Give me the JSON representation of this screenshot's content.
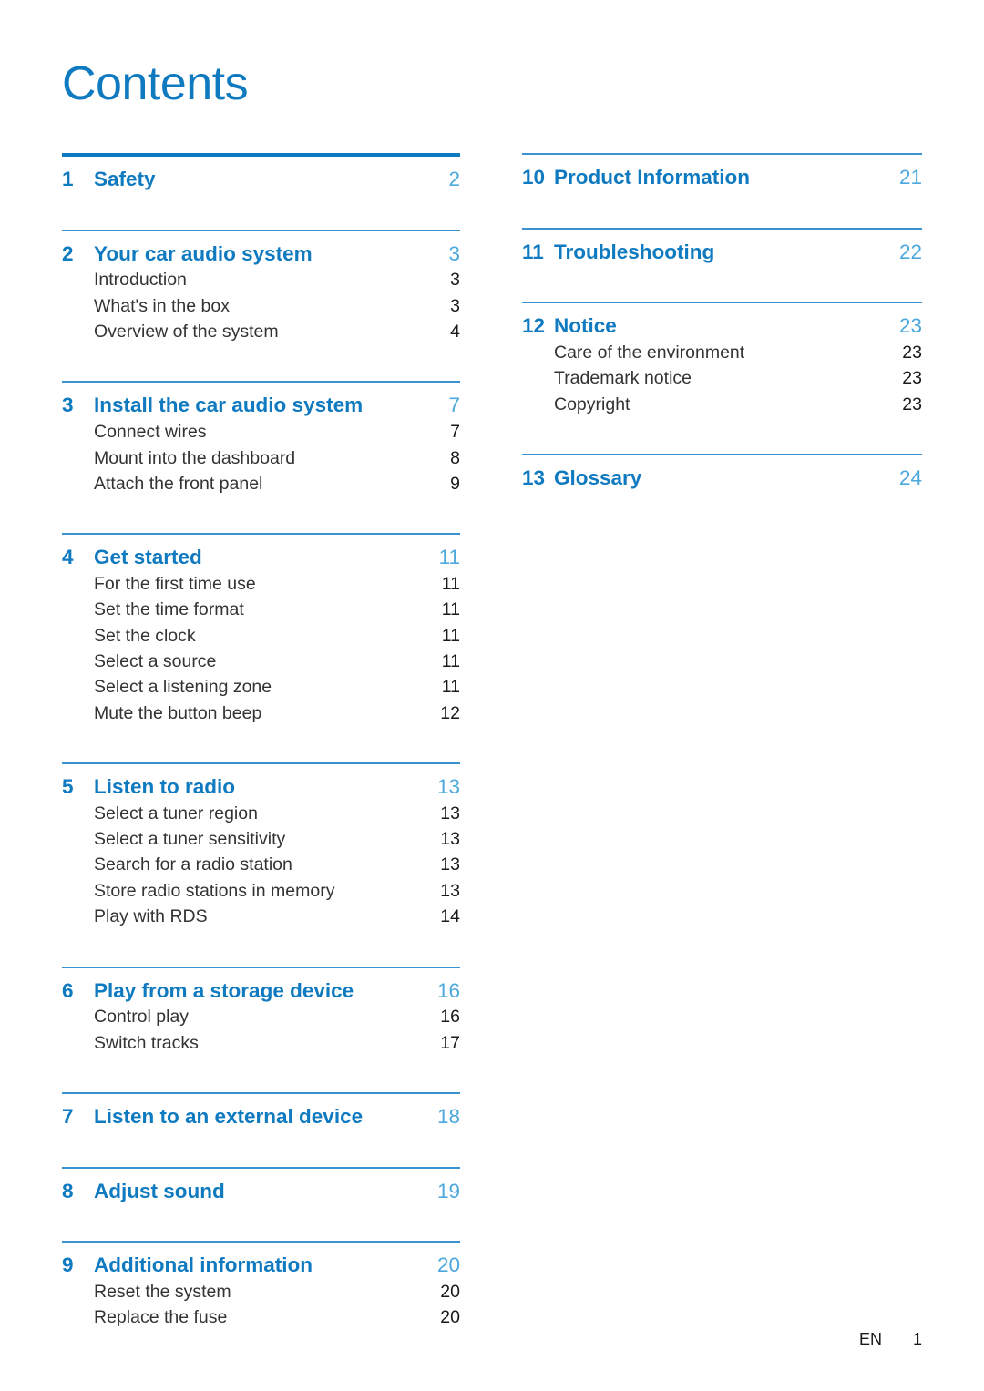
{
  "document": {
    "title": "Contents"
  },
  "colors": {
    "heading_blue": "#0f7ac0",
    "page_number_blue": "#4da8dd",
    "rule_blue": "#3a93cf",
    "body_text": "#333333"
  },
  "left_column": [
    {
      "number": "1",
      "title": "Safety",
      "page": "2",
      "rule": "heavy",
      "subitems": []
    },
    {
      "number": "2",
      "title": "Your car audio system",
      "page": "3",
      "rule": "thin",
      "subitems": [
        {
          "title": "Introduction",
          "page": "3"
        },
        {
          "title": "What's in the box",
          "page": "3"
        },
        {
          "title": "Overview of the system",
          "page": "4"
        }
      ]
    },
    {
      "number": "3",
      "title": "Install the car audio system",
      "page": "7",
      "rule": "thin",
      "subitems": [
        {
          "title": "Connect wires",
          "page": "7"
        },
        {
          "title": "Mount into the dashboard",
          "page": "8"
        },
        {
          "title": "Attach the front panel",
          "page": "9"
        }
      ]
    },
    {
      "number": "4",
      "title": "Get started",
      "page": "11",
      "rule": "thin",
      "subitems": [
        {
          "title": "For the first time use",
          "page": "11"
        },
        {
          "title": "Set the time format",
          "page": "11"
        },
        {
          "title": "Set the clock",
          "page": "11"
        },
        {
          "title": "Select a source",
          "page": "11"
        },
        {
          "title": "Select a listening zone",
          "page": "11"
        },
        {
          "title": "Mute the button beep",
          "page": "12"
        }
      ]
    },
    {
      "number": "5",
      "title": "Listen to radio",
      "page": "13",
      "rule": "thin",
      "subitems": [
        {
          "title": "Select a tuner region",
          "page": "13"
        },
        {
          "title": "Select a tuner sensitivity",
          "page": "13"
        },
        {
          "title": "Search for a radio station",
          "page": "13"
        },
        {
          "title": "Store radio stations in memory",
          "page": "13"
        },
        {
          "title": "Play with RDS",
          "page": "14"
        }
      ]
    },
    {
      "number": "6",
      "title": "Play from a storage device",
      "page": "16",
      "rule": "thin",
      "subitems": [
        {
          "title": "Control play",
          "page": "16"
        },
        {
          "title": "Switch tracks",
          "page": "17"
        }
      ]
    },
    {
      "number": "7",
      "title": "Listen to an external device",
      "page": "18",
      "rule": "thin",
      "subitems": []
    },
    {
      "number": "8",
      "title": "Adjust sound",
      "page": "19",
      "rule": "thin",
      "subitems": []
    },
    {
      "number": "9",
      "title": "Additional information",
      "page": "20",
      "rule": "thin",
      "subitems": [
        {
          "title": "Reset the system",
          "page": "20"
        },
        {
          "title": "Replace the fuse",
          "page": "20"
        }
      ]
    }
  ],
  "right_column": [
    {
      "number": "10",
      "title": "Product Information",
      "page": "21",
      "rule": "thin",
      "subitems": []
    },
    {
      "number": "11",
      "title": "Troubleshooting",
      "page": "22",
      "rule": "thin",
      "subitems": []
    },
    {
      "number": "12",
      "title": "Notice",
      "page": "23",
      "rule": "thin",
      "subitems": [
        {
          "title": "Care of the environment",
          "page": "23"
        },
        {
          "title": "Trademark notice",
          "page": "23"
        },
        {
          "title": "Copyright",
          "page": "23"
        }
      ]
    },
    {
      "number": "13",
      "title": "Glossary",
      "page": "24",
      "rule": "thin",
      "subitems": []
    }
  ],
  "footer": {
    "language": "EN",
    "page_number": "1"
  }
}
